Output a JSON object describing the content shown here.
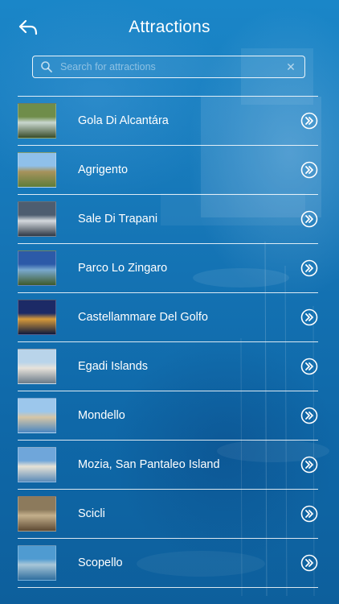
{
  "header": {
    "title": "Attractions",
    "back_icon": "back-arrow-icon"
  },
  "search": {
    "placeholder": "Search for attractions",
    "value": "",
    "clear_label": "✕"
  },
  "colors": {
    "background": "#1478bb",
    "text": "#ffffff"
  },
  "attractions": [
    {
      "label": "Gola Di Alcantára",
      "thumb": [
        "#6f8d4a",
        "#c9d7cf",
        "#394d2a"
      ]
    },
    {
      "label": "Agrigento",
      "thumb": [
        "#8fc0ea",
        "#a7935c",
        "#5e7d3a"
      ]
    },
    {
      "label": "Sale Di Trapani",
      "thumb": [
        "#4d5d70",
        "#d5d9de",
        "#2f3946"
      ]
    },
    {
      "label": "Parco Lo Zingaro",
      "thumb": [
        "#2c5aa8",
        "#79a9cf",
        "#3e5a2b"
      ]
    },
    {
      "label": "Castellammare Del Golfo",
      "thumb": [
        "#1c2a66",
        "#d79a3a",
        "#0f1a3d"
      ]
    },
    {
      "label": "Egadi Islands",
      "thumb": [
        "#b9d4ea",
        "#e7e2da",
        "#6a7b89"
      ]
    },
    {
      "label": "Mondello",
      "thumb": [
        "#9cc7ec",
        "#d6c6a6",
        "#4b86c0"
      ]
    },
    {
      "label": "Mozia, San Pantaleo Island",
      "thumb": [
        "#6fa6da",
        "#e6e2d6",
        "#5b8bb8"
      ]
    },
    {
      "label": "Scicli",
      "thumb": [
        "#8c7a5c",
        "#c4b08c",
        "#5e4a33"
      ]
    },
    {
      "label": "Scopello",
      "thumb": [
        "#4f9bd1",
        "#a8c7d8",
        "#2f6e9e"
      ]
    }
  ]
}
